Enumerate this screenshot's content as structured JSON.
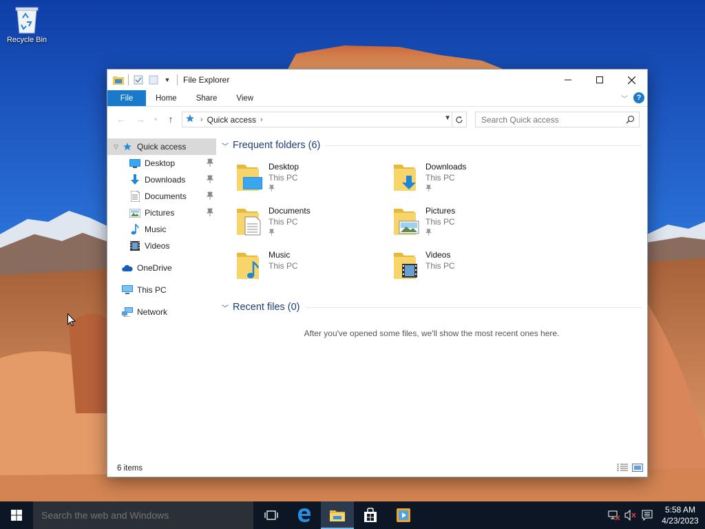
{
  "desktop": {
    "recycle_bin_label": "Recycle Bin"
  },
  "window": {
    "title": "File Explorer",
    "controls": {
      "minimize": "—",
      "maximize": "☐",
      "close": "✕"
    },
    "ribbon_tabs": [
      "File",
      "Home",
      "Share",
      "View"
    ],
    "help_label": "?",
    "address": {
      "crumbs": [
        "Quick access"
      ]
    },
    "search_placeholder": "Search Quick access",
    "nav_pane": {
      "quick_access": "Quick access",
      "pinned": [
        "Desktop",
        "Downloads",
        "Documents",
        "Pictures"
      ],
      "unpinned": [
        "Music",
        "Videos"
      ],
      "roots": [
        "OneDrive",
        "This PC",
        "Network"
      ]
    },
    "frequent_folders": {
      "title": "Frequent folders (6)",
      "items": [
        {
          "name": "Desktop",
          "location": "This PC",
          "pinned": true,
          "icon": "desktop-folder-icon"
        },
        {
          "name": "Downloads",
          "location": "This PC",
          "pinned": true,
          "icon": "downloads-folder-icon"
        },
        {
          "name": "Documents",
          "location": "This PC",
          "pinned": true,
          "icon": "documents-folder-icon"
        },
        {
          "name": "Pictures",
          "location": "This PC",
          "pinned": true,
          "icon": "pictures-folder-icon"
        },
        {
          "name": "Music",
          "location": "This PC",
          "pinned": false,
          "icon": "music-folder-icon"
        },
        {
          "name": "Videos",
          "location": "This PC",
          "pinned": false,
          "icon": "videos-folder-icon"
        }
      ]
    },
    "recent_files": {
      "title": "Recent files (0)",
      "empty_message": "After you've opened some files, we'll show the most recent ones here."
    },
    "status": {
      "item_count": "6 items"
    }
  },
  "taskbar": {
    "search_placeholder": "Search the web and Windows",
    "clock": {
      "time": "5:58 AM",
      "date": "4/23/2023"
    }
  },
  "colors": {
    "accent": "#1979ca",
    "group_title": "#1e3c7b",
    "taskbar": "#0d1625",
    "folder_yellow": "#f3c94a"
  }
}
